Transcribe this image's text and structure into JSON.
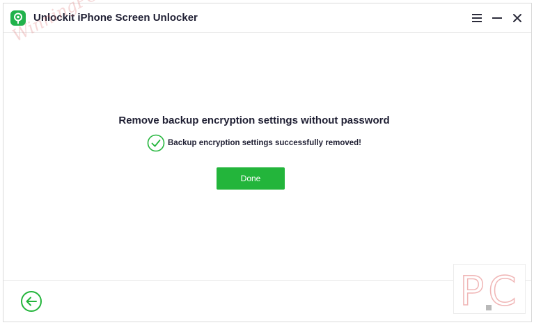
{
  "app": {
    "title": "Unlockit iPhone Screen Unlocker",
    "icon": "location-pin-icon"
  },
  "window_controls": {
    "menu_icon": "hamburger-menu-icon",
    "minimize_icon": "minimize-icon",
    "close_icon": "close-icon"
  },
  "watermark": {
    "text": "WinningPC"
  },
  "main": {
    "title": "Remove backup encryption settings without password",
    "status_text": "Backup encryption settings successfully removed!",
    "status_icon": "check-circle-icon",
    "done_label": "Done"
  },
  "footer": {
    "back_icon": "back-arrow-icon"
  },
  "corner_logo": {
    "text": "PC"
  },
  "colors": {
    "accent": "#23b53b",
    "title_text": "#1f1f33",
    "border": "#e6e6e6"
  }
}
